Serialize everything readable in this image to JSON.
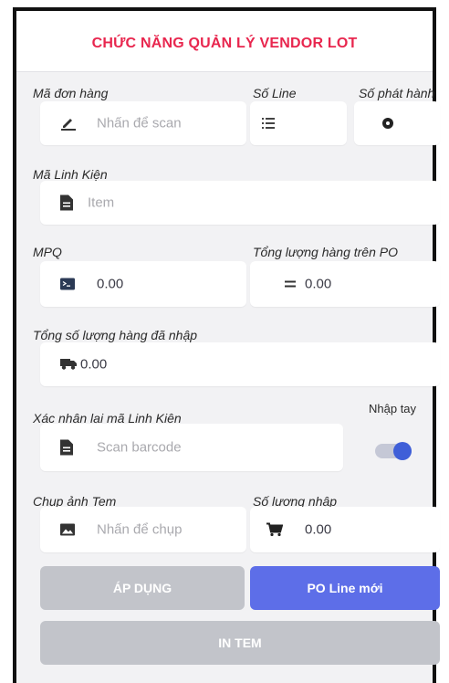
{
  "header": {
    "title": "CHỨC NĂNG QUẢN LÝ VENDOR LOT"
  },
  "fields": {
    "order_code": {
      "label": "Mã đơn hàng",
      "placeholder": "Nhấn để scan",
      "icon": "pencil-icon"
    },
    "line_no": {
      "label": "Số Line",
      "icon": "list-icon"
    },
    "issue_no": {
      "label": "Số phát hành",
      "icon": "settings-icon"
    },
    "part_code": {
      "label": "Mã Linh Kiện",
      "placeholder": "Item",
      "icon": "document-icon"
    },
    "mpq": {
      "label": "MPQ",
      "value": "0.00",
      "icon": "terminal-icon"
    },
    "po_total": {
      "label": "Tổng lượng hàng trên PO",
      "value": "0.00",
      "icon": "equals-icon"
    },
    "received_total": {
      "label": "Tổng số lượng hàng đã nhập",
      "value": "0.00",
      "icon": "truck-icon"
    },
    "confirm_part": {
      "label": "Xác nhận lại mã Linh Kiện",
      "placeholder": "Scan barcode",
      "icon": "document-icon"
    },
    "manual_input": {
      "label": "Nhập tay",
      "state": "on"
    },
    "photo": {
      "label": "Chụp ảnh Tem",
      "placeholder": "Nhấn để chụp",
      "icon": "image-icon"
    },
    "input_qty": {
      "label": "Số lượng nhập",
      "value": "0.00",
      "icon": "cart-icon"
    }
  },
  "buttons": {
    "apply": "ÁP DỤNG",
    "new_po_line": "PO Line mới",
    "print_label": "IN TEM"
  },
  "colors": {
    "title": "#e8264e",
    "accent": "#5d6ee8",
    "disabled": "#c2c4ca"
  }
}
